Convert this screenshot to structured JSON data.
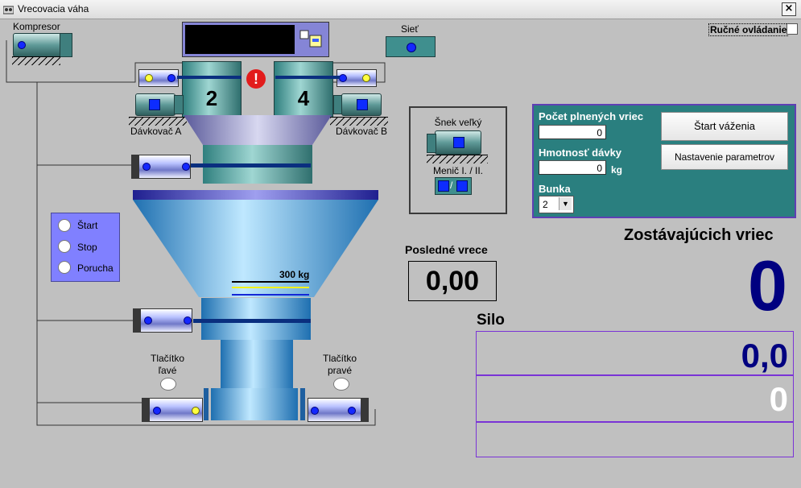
{
  "window": {
    "title": "Vrecovacia váha",
    "close_symbol": "×"
  },
  "manual_control": {
    "label": "Ručné ovládanie",
    "checked": false
  },
  "labels": {
    "compressor": "Kompresor",
    "network": "Sieť",
    "doser_a": "Dávkovač A",
    "doser_b": "Dávkovač B",
    "auger": "Šnek veľký",
    "inverter": "Menič I. / II.",
    "inverter_sep": "/",
    "weight_mark": "300 kg",
    "button_left": "Tlačítko\nľavé",
    "button_right": "Tlačítko\npravé",
    "last_bag": "Posledné vrece",
    "remaining_bags": "Zostávajúcich vriec",
    "silo": "Silo"
  },
  "hoppers": {
    "left_number": "2",
    "right_number": "4",
    "alert_symbol": "!"
  },
  "status": {
    "start": "Štart",
    "stop": "Stop",
    "fault": "Porucha"
  },
  "form": {
    "bag_count_label": "Počet plnených vriec",
    "bag_count_value": "0",
    "dose_weight_label": "Hmotnosť dávky",
    "dose_weight_value": "0",
    "dose_unit": "kg",
    "cell_label": "Bunka",
    "cell_value": "2",
    "start_button": "Štart váženia",
    "settings_button": "Nastavenie parametrov"
  },
  "readouts": {
    "last_bag_value": "0,00",
    "remaining_value": "0",
    "silo_weight": "0,0",
    "silo_count": "0"
  },
  "colors": {
    "panel": "#2a7f7f",
    "accent_blue": "#000080",
    "border_purple": "#7a33d6"
  }
}
